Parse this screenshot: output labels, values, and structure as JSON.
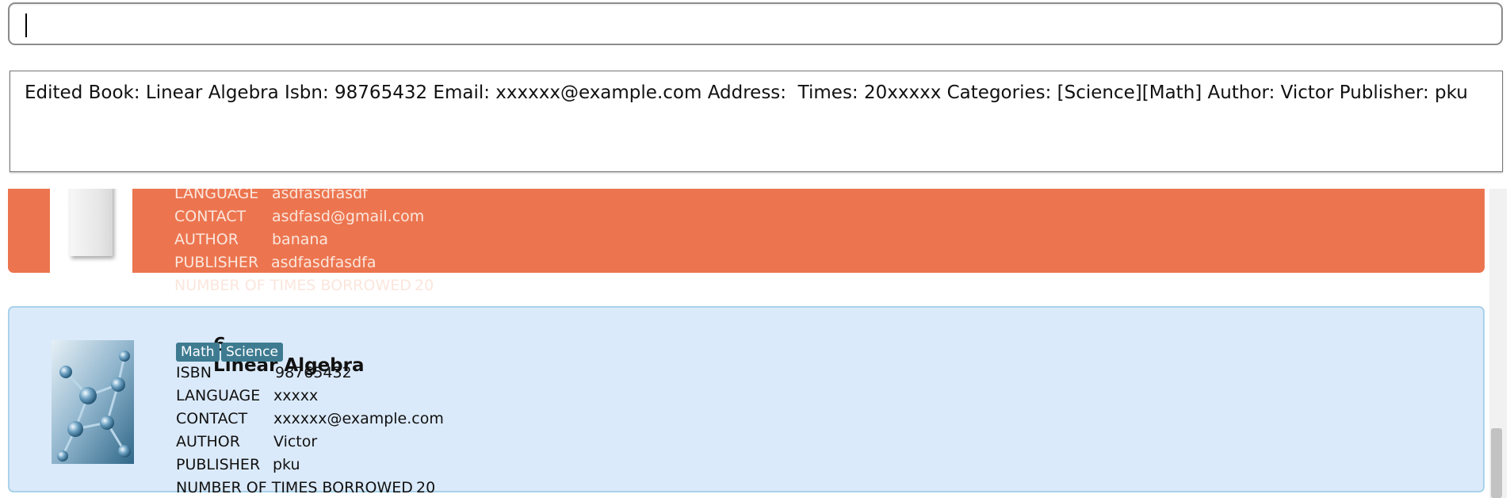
{
  "command_box": {
    "value": "",
    "placeholder": ""
  },
  "result_display": {
    "text": "Edited Book: Linear Algebra Isbn: 98765432 Email: xxxxxx@example.com Address:  Times: 20xxxxx Categories: [Science][Math] Author: Victor Publisher: pku"
  },
  "book_list": {
    "cards": [
      {
        "state": "selected",
        "fields": [
          {
            "label": "LANGUAGE",
            "value": "asdfasdfasdf"
          },
          {
            "label": "CONTACT",
            "value": "asdfasd@gmail.com"
          },
          {
            "label": "AUTHOR",
            "value": "banana"
          },
          {
            "label": "PUBLISHER",
            "value": "asdfasdfasdfa"
          },
          {
            "label": "NUMBER OF TIMES BORROWED",
            "value": "20"
          }
        ]
      },
      {
        "state": "normal",
        "index": "6.",
        "title": "Linear Algebra",
        "tags": [
          "Math",
          "Science"
        ],
        "fields": [
          {
            "label": "ISBN",
            "value": "98765432"
          },
          {
            "label": "LANGUAGE",
            "value": "xxxxx"
          },
          {
            "label": "CONTACT",
            "value": "xxxxxx@example.com"
          },
          {
            "label": "AUTHOR",
            "value": "Victor"
          },
          {
            "label": "PUBLISHER",
            "value": "pku"
          },
          {
            "label": "NUMBER OF TIMES BORROWED",
            "value": "20"
          }
        ]
      }
    ]
  },
  "colors": {
    "selected_card": "#ec754f",
    "normal_card": "#dbeafa",
    "tag": "#3e7b91"
  },
  "icons": {
    "blank_cover": "book-cover-blank-icon",
    "molecule_cover": "molecule-cover-icon"
  }
}
